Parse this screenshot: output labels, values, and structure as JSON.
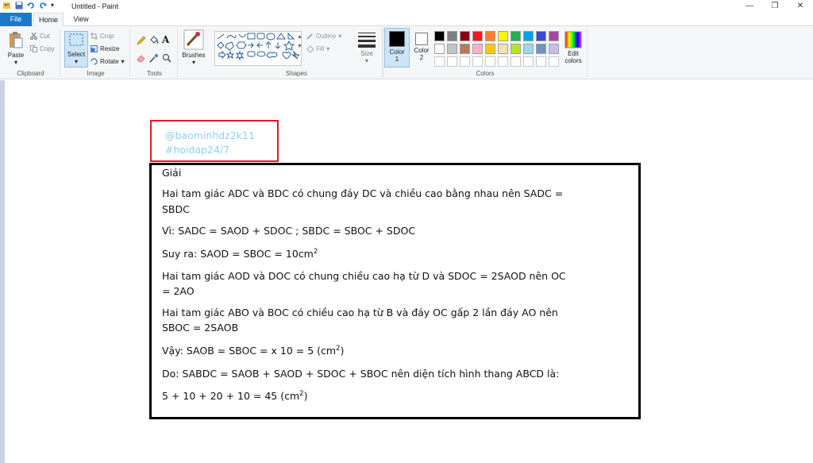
{
  "window": {
    "title": "Untitled - Paint"
  },
  "tabs": {
    "file": "File",
    "home": "Home",
    "view": "View"
  },
  "ribbon": {
    "clipboard": {
      "paste": "Paste",
      "cut": "Cut",
      "copy": "Copy",
      "group_label": "Clipboard"
    },
    "image": {
      "select": "Select",
      "crop": "Crop",
      "resize": "Resize",
      "rotate": "Rotate",
      "group_label": "Image"
    },
    "tools": {
      "group_label": "Tools"
    },
    "brushes": {
      "label": "Brushes"
    },
    "shapes": {
      "outline": "Outline",
      "fill": "Fill",
      "group_label": "Shapes"
    },
    "size": {
      "label": "Size"
    },
    "color1": {
      "label": "Color",
      "num": "1"
    },
    "color2": {
      "label": "Color",
      "num": "2"
    },
    "colors": {
      "group_label": "Colors",
      "edit_label1": "Edit",
      "edit_label2": "colors",
      "row1": [
        "#000000",
        "#7f7f7f",
        "#880015",
        "#ed1c24",
        "#ff7f27",
        "#fff200",
        "#22b14c",
        "#00a2e8",
        "#3f48cc",
        "#a349a4"
      ],
      "row2": [
        "#ffffff",
        "#c3c3c3",
        "#b97a57",
        "#ffaec9",
        "#ffc90e",
        "#efe4b0",
        "#b5e61d",
        "#99d9ea",
        "#7092be",
        "#c8bfe7"
      ]
    }
  },
  "canvas": {
    "handle1": "@baominhdz2k11",
    "handle2": "#hoidap24/7",
    "lines": {
      "l1": "Giải",
      "l2": " Hai tam giác ADC và BDC có chung đáy DC và chiều cao bằng nhau nên SADC =",
      "l3": "SBDC",
      "l4": "Vì: SADC = SAOD + SDOC ; SBDC = SBOC + SDOC",
      "l5a": "Suy ra: SAOD = SBOC = 10cm",
      "l5sup": "2",
      "l6": "Hai tam giác AOD và DOC có chung chiều cao hạ từ D và SDOC = 2SAOD nên OC",
      "l7": "= 2AO",
      "l8": "Hai tam giác ABO và BOC có chiều cao hạ từ B và đáy OC gấp 2 lần đáy AO nên",
      "l9": "SBOC = 2SAOB",
      "l10a": "Vậy: SAOB = SBOC = x 10 = 5 (cm",
      "l10sup": "2",
      "l10b": ")",
      "l11": "Do: SABDC = SAOB + SAOD + SDOC + SBOC nên diện tích hình thang ABCD là:",
      "l12a": "5 + 10 + 20 + 10 = 45 (cm",
      "l12sup": "2",
      "l12b": ")"
    }
  }
}
